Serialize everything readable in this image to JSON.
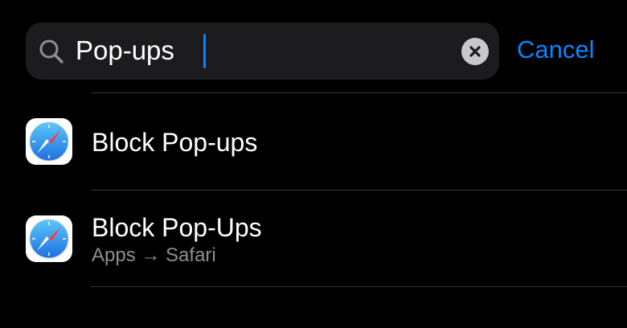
{
  "search": {
    "value": "Pop-ups",
    "cancel_label": "Cancel"
  },
  "icons": {
    "search": "magnifying-glass-icon",
    "clear": "clear-circle-icon",
    "app": "safari-compass-icon"
  },
  "colors": {
    "background": "#000000",
    "search_field": "#1c1c1e",
    "accent": "#0a84ff",
    "secondary_text": "#8e8e93",
    "divider": "#38383a"
  },
  "results": [
    {
      "title": "Block Pop-ups",
      "subtitle": ""
    },
    {
      "title": "Block Pop-Ups",
      "subtitle": "Apps → Safari"
    }
  ]
}
